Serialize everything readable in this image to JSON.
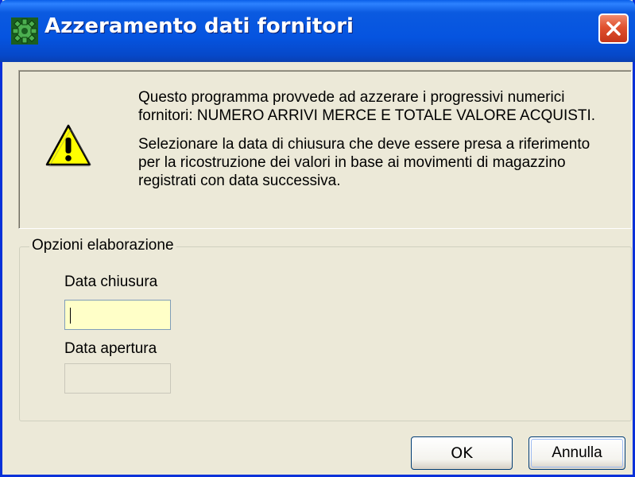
{
  "window": {
    "title": "Azzeramento dati fornitori",
    "app_icon": "green-gear-icon",
    "close_icon": "close-icon"
  },
  "info": {
    "icon": "warning-icon",
    "paragraph1": "Questo programma provvede ad azzerare i progressivi numerici fornitori: NUMERO ARRIVI MERCE E TOTALE VALORE ACQUISTI.",
    "paragraph2": "Selezionare la data di chiusura che deve essere presa a riferimento per la ricostruzione dei valori in base ai movimenti di magazzino registrati con data successiva."
  },
  "options": {
    "legend": "Opzioni elaborazione",
    "data_chiusura_label": "Data chiusura",
    "data_chiusura_value": "",
    "data_apertura_label": "Data apertura",
    "data_apertura_value": ""
  },
  "buttons": {
    "ok_label": "OK",
    "cancel_label": "Annulla"
  },
  "colors": {
    "titlebar": "#0554e0",
    "dialog_bg": "#ece9d8",
    "active_input_bg": "#ffffc8",
    "close_button": "#e0512f",
    "warning_yellow": "#ffff00"
  }
}
